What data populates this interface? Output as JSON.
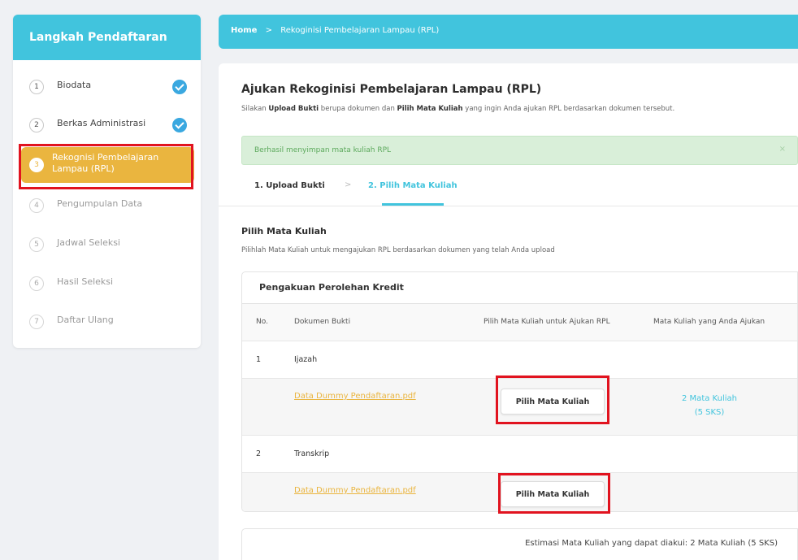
{
  "sidebar": {
    "title": "Langkah Pendaftaran",
    "steps": [
      {
        "num": "1",
        "label": "Biodata"
      },
      {
        "num": "2",
        "label": "Berkas Administrasi"
      },
      {
        "num": "3",
        "label": "Rekognisi Pembelajaran Lampau (RPL)"
      },
      {
        "num": "4",
        "label": "Pengumpulan Data"
      },
      {
        "num": "5",
        "label": "Jadwal Seleksi"
      },
      {
        "num": "6",
        "label": "Hasil Seleksi"
      },
      {
        "num": "7",
        "label": "Daftar Ulang"
      }
    ]
  },
  "breadcrumb": {
    "home": "Home",
    "separator": ">",
    "current": "Rekoginisi Pembelajaran Lampau (RPL)"
  },
  "page": {
    "title": "Ajukan Rekoginisi Pembelajaran Lampau (RPL)",
    "subtitle_pre": "Silakan ",
    "subtitle_bold1": "Upload Bukti",
    "subtitle_mid": " berupa dokumen dan ",
    "subtitle_bold2": "Pilih Mata Kuliah",
    "subtitle_post": " yang ingin Anda ajukan RPL berdasarkan dokumen tersebut."
  },
  "alert": {
    "message": "Berhasil menyimpan mata kuliah RPL",
    "close": "×"
  },
  "tabs": {
    "upload": "1. Upload Bukti",
    "separator": ">",
    "pick": "2. Pilih Mata Kuliah"
  },
  "section": {
    "title": "Pilih Mata Kuliah",
    "subtitle": "Pilihlah Mata Kuliah untuk mengajukan RPL berdasarkan dokumen yang telah Anda upload"
  },
  "table": {
    "title": "Pengakuan Perolehan Kredit",
    "headers": {
      "no": "No.",
      "doc": "Dokumen Bukti",
      "pick": "Pilih Mata Kuliah untuk Ajukan RPL",
      "selected": "Mata Kuliah yang Anda Ajukan"
    },
    "groups": [
      {
        "no": "1",
        "name": "Ijazah",
        "file": "Data Dummy Pendaftaran.pdf",
        "button": "Pilih Mata Kuliah",
        "selected_line1": "2 Mata Kuliah",
        "selected_line2": "(5 SKS)"
      },
      {
        "no": "2",
        "name": "Transkrip",
        "file": "Data Dummy Pendaftaran.pdf",
        "button": "Pilih Mata Kuliah"
      }
    ]
  },
  "estimate": "Estimasi Mata Kuliah yang dapat diakui: 2 Mata Kuliah (5 SKS)"
}
